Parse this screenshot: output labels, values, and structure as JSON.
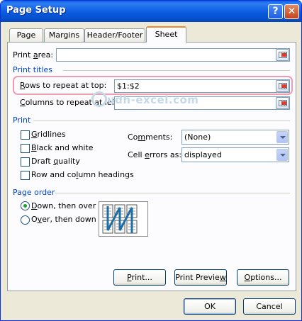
{
  "window": {
    "title": "Page Setup"
  },
  "titlebar": {
    "help": "?",
    "close": "✕"
  },
  "tabs": [
    {
      "label": "Page"
    },
    {
      "label": "Margins"
    },
    {
      "label": "Header/Footer"
    },
    {
      "label": "Sheet"
    }
  ],
  "print_area": {
    "label_pre": "Print ",
    "label_u": "a",
    "label_post": "rea:",
    "value": ""
  },
  "print_titles": {
    "heading": "Print titles",
    "rows": {
      "label_u": "R",
      "label_post": "ows to repeat at top:",
      "value": "$1:$2"
    },
    "cols": {
      "label_u": "C",
      "label_post": "olumns to repeat at left:",
      "value": ""
    }
  },
  "watermark": "udh-excel.com",
  "print": {
    "heading": "Print",
    "gridlines": {
      "label_u": "G",
      "label_post": "ridlines"
    },
    "bw": {
      "label_u": "B",
      "label_post": "lack and white"
    },
    "draft": {
      "label_pre": "Draft ",
      "label_u": "q",
      "label_post": "uality"
    },
    "headings": {
      "label_pre": "Row and co",
      "label_u": "l",
      "label_post": "umn headings"
    },
    "comments": {
      "label_pre": "Co",
      "label_u": "m",
      "label_post": "ments:",
      "value": "(None)"
    },
    "errors": {
      "label_pre": "Cell ",
      "label_u": "e",
      "label_post": "rrors as:",
      "value": "displayed"
    }
  },
  "page_order": {
    "heading": "Page order",
    "down": {
      "label_u": "D",
      "label_post": "own, then over"
    },
    "over": {
      "label_pre": "O",
      "label_u": "v",
      "label_post": "er, then down"
    }
  },
  "buttons": {
    "print": {
      "label_u": "P",
      "label_post": "rint..."
    },
    "preview": {
      "label_pre": "Print Previe",
      "label_u": "w",
      "label_post": ""
    },
    "options": {
      "label_u": "O",
      "label_post": "ptions..."
    },
    "ok": "OK",
    "cancel": "Cancel"
  }
}
